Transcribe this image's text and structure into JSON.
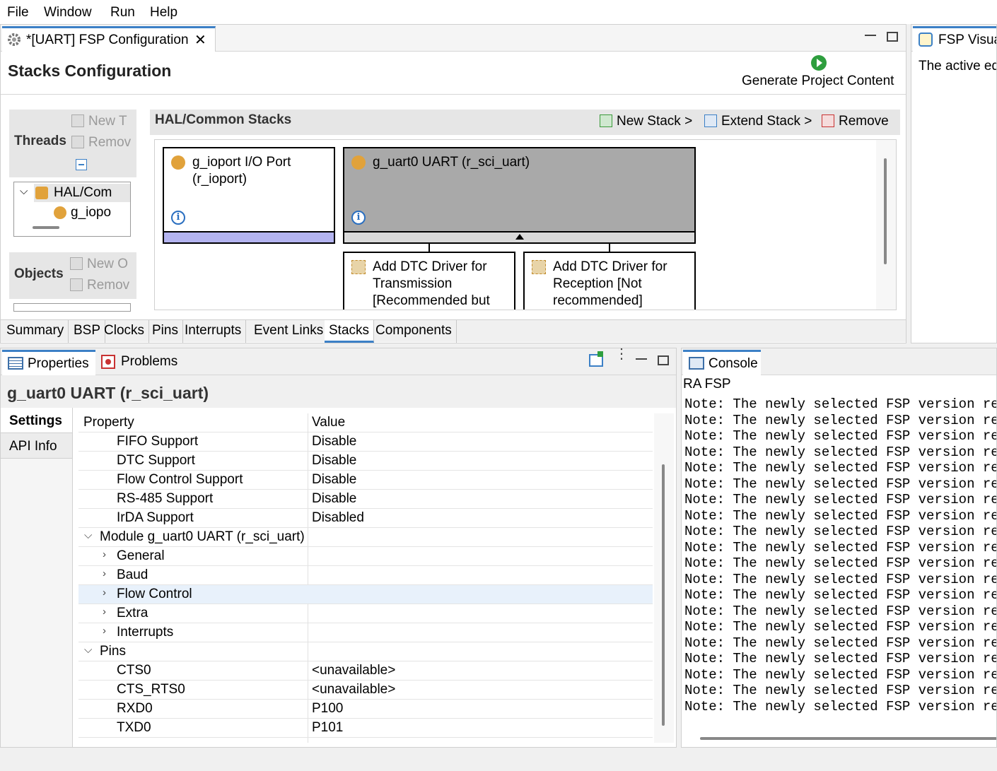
{
  "menu": [
    "File",
    "Window",
    "Run",
    "Help"
  ],
  "editor": {
    "tab_title": "*[UART] FSP Configuration",
    "heading": "Stacks Configuration",
    "generate_label": "Generate Project Content"
  },
  "threads": {
    "title": "Threads",
    "new_label": "New T",
    "remove_label": "Remov",
    "tree": [
      "HAL/Com",
      "g_iopo"
    ]
  },
  "objects": {
    "title": "Objects",
    "new_label": "New O",
    "remove_label": "Remov"
  },
  "hal": {
    "title": "HAL/Common Stacks",
    "new_stack": "New Stack >",
    "extend_stack": "Extend Stack >",
    "remove": "Remove",
    "modules": {
      "ioport": "g_ioport I/O Port (r_ioport)",
      "uart": "g_uart0 UART (r_sci_uart)",
      "dtc_tx": "Add DTC Driver for Transmission [Recommended but",
      "dtc_rx": "Add DTC Driver for Reception [Not recommended]"
    }
  },
  "editor_tabs": [
    "Summary",
    "BSP",
    "Clocks",
    "Pins",
    "Interrupts",
    "Event Links",
    "Stacks",
    "Components"
  ],
  "editor_tabs_active": "Stacks",
  "fsp_visual": {
    "title": "FSP Visua",
    "text": "The active ed"
  },
  "properties": {
    "tab_properties": "Properties",
    "tab_problems": "Problems",
    "title": "g_uart0 UART (r_sci_uart)",
    "side_tabs": [
      "Settings",
      "API Info"
    ],
    "col_property": "Property",
    "col_value": "Value",
    "rows": [
      {
        "label": "FIFO Support",
        "value": "Disable"
      },
      {
        "label": "DTC Support",
        "value": "Disable"
      },
      {
        "label": "Flow Control Support",
        "value": "Disable"
      },
      {
        "label": "RS-485 Support",
        "value": "Disable"
      },
      {
        "label": "IrDA Support",
        "value": "Disabled"
      },
      {
        "label": "Module g_uart0 UART (r_sci_uart)",
        "value": ""
      },
      {
        "label": "General",
        "value": ""
      },
      {
        "label": "Baud",
        "value": ""
      },
      {
        "label": "Flow Control",
        "value": ""
      },
      {
        "label": "Extra",
        "value": ""
      },
      {
        "label": "Interrupts",
        "value": ""
      },
      {
        "label": "Pins",
        "value": ""
      },
      {
        "label": "CTS0",
        "value": "<unavailable>"
      },
      {
        "label": "CTS_RTS0",
        "value": "<unavailable>"
      },
      {
        "label": "RXD0",
        "value": "P100"
      },
      {
        "label": "TXD0",
        "value": "P101"
      }
    ]
  },
  "console": {
    "tab": "Console",
    "subtitle": "RA FSP",
    "lines": [
      "Note: The newly selected FSP version requ",
      "Note: The newly selected FSP version requ",
      "Note: The newly selected FSP version requ",
      "Note: The newly selected FSP version requ",
      "Note: The newly selected FSP version requ",
      "Note: The newly selected FSP version requ",
      "Note: The newly selected FSP version requ",
      "Note: The newly selected FSP version requ",
      "Note: The newly selected FSP version requ",
      "Note: The newly selected FSP version requ",
      "Note: The newly selected FSP version requ",
      "Note: The newly selected FSP version requ",
      "Note: The newly selected FSP version requ",
      "Note: The newly selected FSP version requ",
      "Note: The newly selected FSP version requ",
      "Note: The newly selected FSP version requ",
      "Note: The newly selected FSP version requ",
      "Note: The newly selected FSP version requ",
      "Note: The newly selected FSP version requ",
      "Note: The newly selected FSP version requ"
    ]
  },
  "colors": {
    "accent": "#3c80c6",
    "selected_module": "#a9a9a9",
    "ioport_bar": "#b4b4f0",
    "row_highlight": "#e8f1fb"
  }
}
